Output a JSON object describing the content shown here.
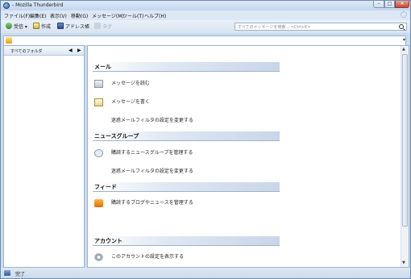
{
  "window": {
    "title": "- Mozilla Thunderbird"
  },
  "menubar": {
    "items": [
      {
        "label": "ファイル(F)"
      },
      {
        "label": "編集(E)"
      },
      {
        "label": "表示(V)"
      },
      {
        "label": "移動(G)"
      },
      {
        "label": "メッセージ(M)"
      },
      {
        "label": "ツール(T)"
      },
      {
        "label": "ヘルプ(H)"
      }
    ]
  },
  "toolbar": {
    "get_label": "受信",
    "write_label": "作成",
    "address_label": "アドレス帳",
    "tag_label": "タグ"
  },
  "search": {
    "placeholder": "すべてのメッセージを検索... <Ctrl+K>"
  },
  "folder_pane": {
    "header": "すべてのフォルダ"
  },
  "sections": [
    {
      "title": "メール",
      "actions": [
        "メッセージを読む",
        "メッセージを書く",
        "迷惑メールフィルタの設定を変更する"
      ]
    },
    {
      "title": "ニュースグループ",
      "actions": [
        "購読するニュースグループを管理する",
        "迷惑メールフィルタの設定を変更する"
      ]
    },
    {
      "title": "フィード",
      "actions": [
        "購読するブログやニュースを管理する"
      ]
    },
    {
      "title": "アカウント",
      "actions": [
        "このアカウントの設定を表示する"
      ]
    }
  ],
  "status": {
    "text": "完了"
  }
}
